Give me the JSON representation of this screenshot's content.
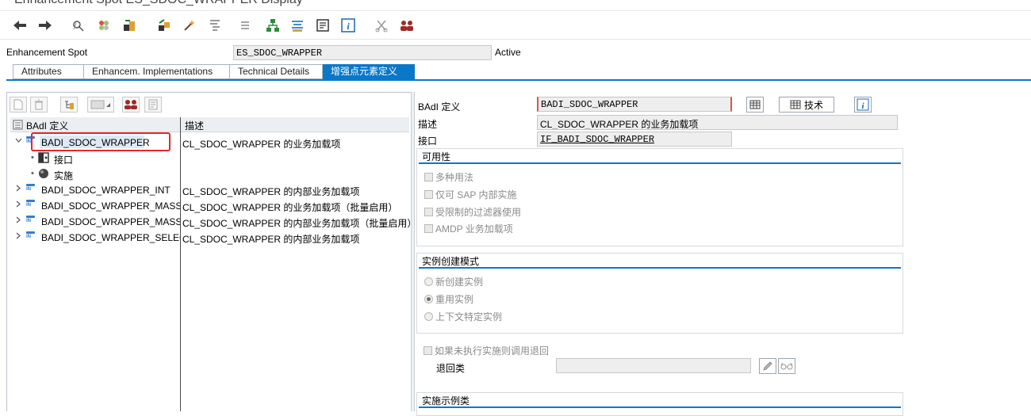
{
  "window": {
    "title": "Enhancement Spot ES_SDOC_WRAPPER Display"
  },
  "toolbar": {
    "icons": [
      "back-icon",
      "forward-icon",
      "display-change-icon",
      "other-object-icon",
      "activate-icon",
      "where-used-icon",
      "enhance-icon",
      "display-object-list-icon",
      "hierarchy-icon",
      "structure-icon",
      "documentation-icon",
      "info-icon",
      "cut-icon",
      "users-icon"
    ]
  },
  "header": {
    "label": "Enhancement Spot",
    "value": "ES_SDOC_WRAPPER",
    "status": "Active"
  },
  "tabs": [
    "Attributes",
    "Enhancem. Implementations",
    "Technical Details",
    "增强点元素定义"
  ],
  "tree": {
    "col1": "BAdI 定义",
    "col2": "描述",
    "rows": [
      {
        "name": "BADI_SDOC_WRAPPER",
        "desc": "CL_SDOC_WRAPPER 的业务加载项"
      },
      {
        "name": "接口",
        "desc": ""
      },
      {
        "name": "实施",
        "desc": ""
      },
      {
        "name": "BADI_SDOC_WRAPPER_INT",
        "desc": "CL_SDOC_WRAPPER 的内部业务加载项"
      },
      {
        "name": "BADI_SDOC_WRAPPER_MASS",
        "desc": "CL_SDOC_WRAPPER 的业务加载项（批量启用）"
      },
      {
        "name": "BADI_SDOC_WRAPPER_MASS_I",
        "desc": "CL_SDOC_WRAPPER 的内部业务加载项（批量启用）"
      },
      {
        "name": "BADI_SDOC_WRAPPER_SELECT",
        "desc": "CL_SDOC_WRAPPER 的内部业务加载项"
      }
    ]
  },
  "form": {
    "badi_label": "BAdI 定义",
    "badi_value": "BADI_SDOC_WRAPPER",
    "tech_button": "技术",
    "desc_label": "描述",
    "desc_value": "CL_SDOC_WRAPPER 的业务加载项",
    "intf_label": "接口",
    "intf_value": "IF_BADI_SDOC_WRAPPER",
    "usability": {
      "title": "可用性",
      "options": [
        "多种用法",
        "仅可 SAP 内部实施",
        "受限制的过滤器使用",
        "AMDP 业务加载项"
      ]
    },
    "instance": {
      "title": "实例创建模式",
      "options": [
        "新创建实例",
        "重用实例",
        "上下文特定实例"
      ],
      "selected": "重用实例"
    },
    "fallback_checkbox": "如果未执行实施则调用退回",
    "fallback_label": "退回类",
    "fallback_value": "",
    "sample_title": "实施示例类"
  }
}
